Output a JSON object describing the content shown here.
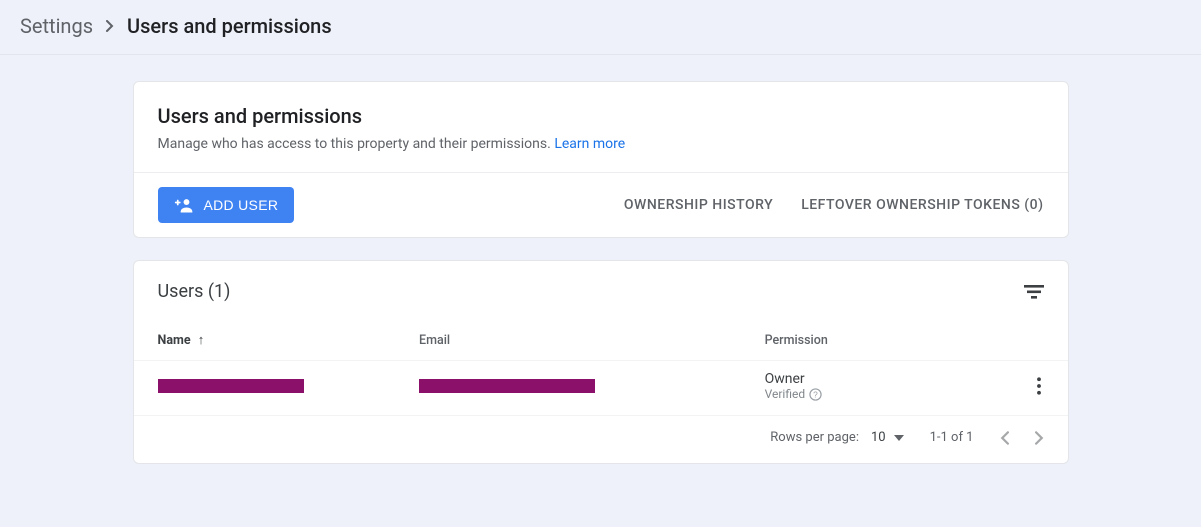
{
  "breadcrumb": {
    "root": "Settings",
    "current": "Users and permissions"
  },
  "header": {
    "title": "Users and permissions",
    "subtitle": "Manage who has access to this property and their permissions.",
    "learn_more": "Learn more"
  },
  "toolbar": {
    "add_user": "ADD USER",
    "ownership_history": "OWNERSHIP HISTORY",
    "leftover_tokens": "LEFTOVER OWNERSHIP TOKENS (0)"
  },
  "users_panel": {
    "title": "Users (1)",
    "columns": {
      "name": "Name",
      "email": "Email",
      "permission": "Permission"
    },
    "rows": [
      {
        "permission": "Owner",
        "permission_sub": "Verified"
      }
    ]
  },
  "pager": {
    "rows_per_page_label": "Rows per page:",
    "rows_per_page_value": "10",
    "range": "1-1 of 1"
  }
}
